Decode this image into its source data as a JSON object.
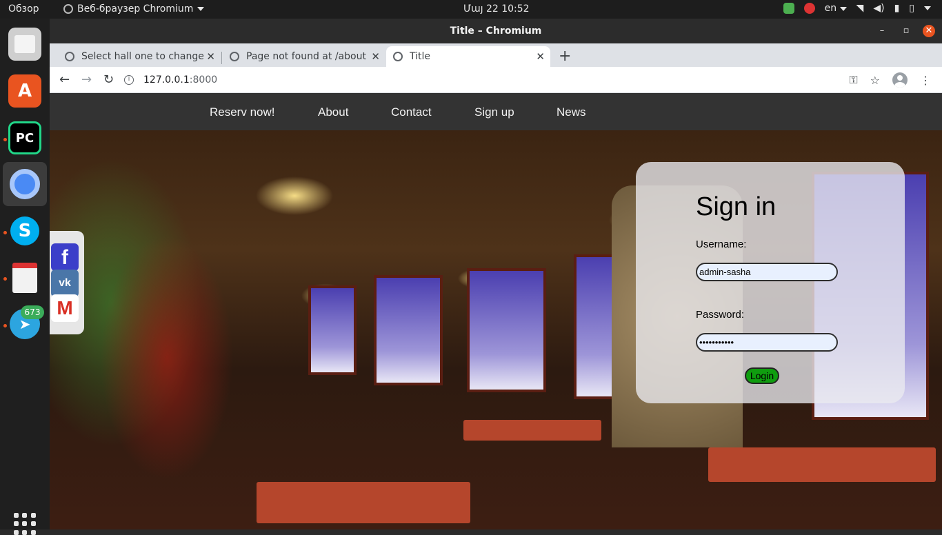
{
  "topbar": {
    "overview": "Обзор",
    "app_menu": "Веб-браузер Chromium",
    "clock": "Մայ 22  10:52",
    "lang": "en"
  },
  "dock": {
    "apps": [
      "files-icon",
      "software-center-icon",
      "pycharm-icon",
      "chromium-icon",
      "skype-icon",
      "document-viewer-icon",
      "telegram-icon"
    ],
    "telegram_badge": "673"
  },
  "window": {
    "title": "Title – Chromium"
  },
  "tabs": [
    {
      "label": "Select hall one to change |"
    },
    {
      "label": "Page not found at /about"
    },
    {
      "label": "Title"
    }
  ],
  "toolbar": {
    "url_host": "127.0.0.1",
    "url_port": ":8000"
  },
  "site": {
    "nav": [
      "Reserv now!",
      "About",
      "Contact",
      "Sign up",
      "News"
    ],
    "social": [
      "f",
      "vk",
      "M"
    ],
    "login": {
      "title": "Sign in",
      "username_label": "Username:",
      "username_value": "admin-sasha",
      "password_label": "Password:",
      "password_value": "•••••••••••",
      "submit": "Login"
    }
  },
  "colors": {
    "accent": "#e95420",
    "nav_bg": "#333333",
    "login_button": "#0f9d0f"
  }
}
